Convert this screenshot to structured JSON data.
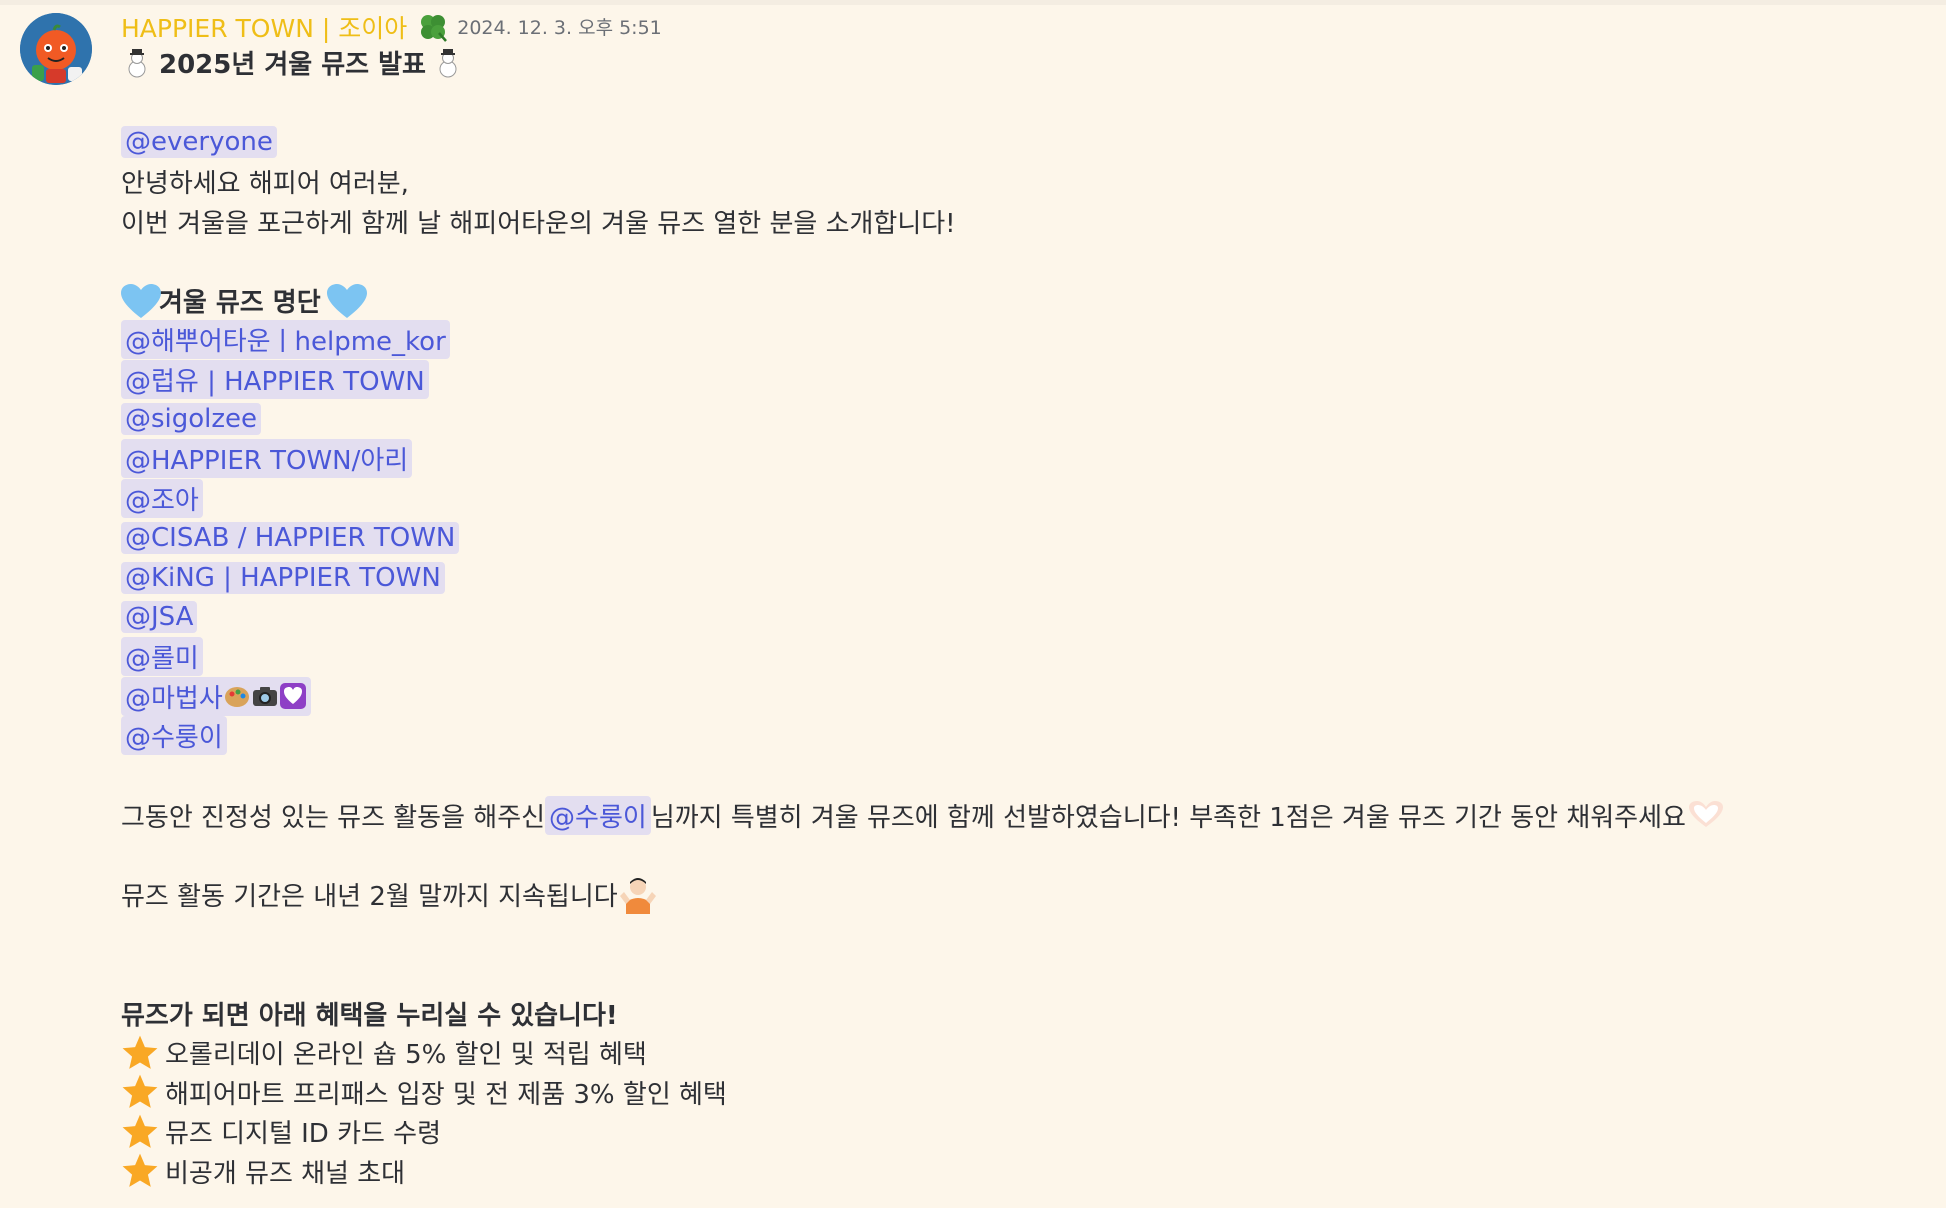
{
  "author": {
    "name": "HAPPIER TOWN | 조이아",
    "timestamp": "2024. 12. 3. 오후 5:51",
    "role_icon": "clover-icon"
  },
  "colors": {
    "username": "#efbe17",
    "mention_text": "#4b58d8",
    "mention_bg": "#e3def0",
    "background": "#fdf6ea"
  },
  "message": {
    "title": "2025년 겨울 뮤즈 발표",
    "everyone_mention": "@everyone",
    "greeting": "안녕하세요 해피어 여러분,",
    "intro": "이번 겨울을 포근하게 함께 날 해피어타운의 겨울 뮤즈 열한 분을 소개합니다!",
    "list_title": "겨울 뮤즈 명단",
    "muses": [
      "@해뿌어타운ㅣhelpme_kor",
      "@럽유 | HAPPIER TOWN",
      "@sigolzee",
      "@HAPPIER TOWN/아리",
      "@조아",
      "@CISAB / HAPPIER TOWN",
      "@KiNG | HAPPIER TOWN",
      "@JSA",
      "@롤미",
      "@마법사",
      "@수룽이"
    ],
    "special_before": "그동안 진정성 있는 뮤즈 활동을 해주신 ",
    "special_mention": "@수룽이",
    "special_after": "님까지 특별히 겨울 뮤즈에 함께 선발하였습니다! 부족한 1점은 겨울 뮤즈 기간 동안 채워주세요",
    "period": "뮤즈 활동 기간은 내년 2월 말까지 지속됩니다",
    "benefits_title": "뮤즈가 되면 아래 혜택을 누리실 수 있습니다!",
    "benefits": [
      "오롤리데이 온라인 숍 5% 할인 및 적립 혜택",
      "해피어마트 프리패스 입장 및 전 제품 3% 할인 혜택",
      "뮤즈 디지털 ID 카드 수령",
      "비공개 뮤즈 채널 초대"
    ]
  }
}
